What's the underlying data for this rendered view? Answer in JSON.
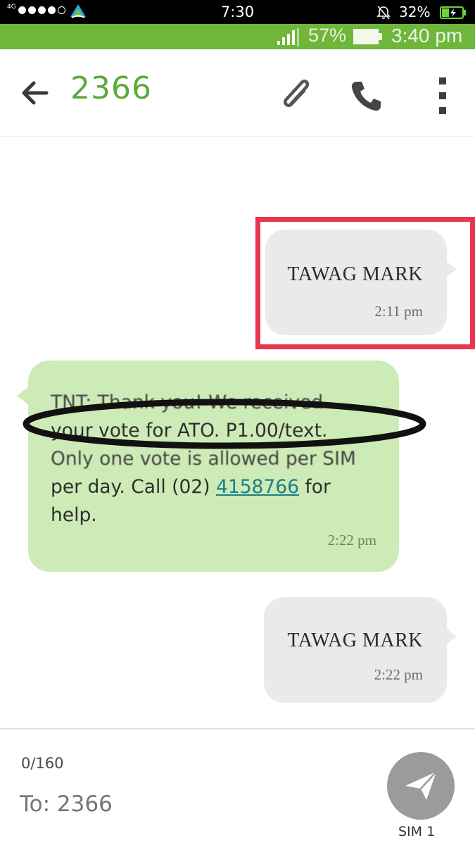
{
  "status_bar": {
    "network": "4G",
    "time": "7:30",
    "battery": "32%"
  },
  "inner_status_bar": {
    "battery": "57%",
    "time": "3:40 pm"
  },
  "toolbar": {
    "title": "2366",
    "icons": [
      "back-arrow-icon",
      "attach-icon",
      "call-icon",
      "more-vert-icon"
    ]
  },
  "messages": [
    {
      "direction": "outgoing",
      "text": "TAWAG MARK",
      "time": "2:11 pm",
      "highlighted": true
    },
    {
      "direction": "incoming",
      "lines": [
        "TNT: Thank you! We received",
        "your vote for ATO. P1.00/text.",
        "Only one vote is allowed per SIM",
        "per day. Call (02) ",
        "4158766",
        " for",
        "help."
      ],
      "time": "2:22 pm"
    },
    {
      "direction": "outgoing",
      "text": "TAWAG MARK",
      "time": "2:22 pm"
    }
  ],
  "composer": {
    "counter": "0/160",
    "to_value": "To: 2366",
    "sim_label": "SIM 1"
  },
  "colors": {
    "accent_green": "#6fb63a",
    "title_green": "#5daa3a",
    "incoming_bubble": "#cdebb6",
    "outgoing_bubble": "#ebeaea",
    "highlight_red": "#e8364f",
    "link": "#1e7f86"
  }
}
